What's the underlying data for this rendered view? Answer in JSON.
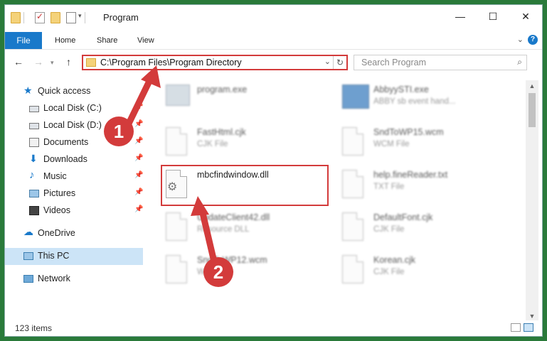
{
  "window": {
    "title": "Program",
    "controls": {
      "minimize": "—",
      "maximize": "☐",
      "close": "✕"
    }
  },
  "ribbon": {
    "tabs": [
      "File",
      "Home",
      "Share",
      "View"
    ],
    "help": "?"
  },
  "navbar": {
    "address_path": "C:\\Program Files\\Program Directory",
    "search_placeholder": "Search Program"
  },
  "sidebar": {
    "items": [
      {
        "label": "Quick access",
        "icon": "star-icon"
      },
      {
        "label": "Local Disk (C:)",
        "icon": "drive-icon",
        "pinned": true
      },
      {
        "label": "Local Disk (D:)",
        "icon": "drive-icon",
        "pinned": true
      },
      {
        "label": "Documents",
        "icon": "documents-icon",
        "pinned": true
      },
      {
        "label": "Downloads",
        "icon": "downloads-icon",
        "pinned": true
      },
      {
        "label": "Music",
        "icon": "music-icon",
        "pinned": true
      },
      {
        "label": "Pictures",
        "icon": "pictures-icon",
        "pinned": true
      },
      {
        "label": "Videos",
        "icon": "videos-icon",
        "pinned": true
      },
      {
        "label": "OneDrive",
        "icon": "cloud-icon"
      },
      {
        "label": "This PC",
        "icon": "computer-icon",
        "selected": true
      },
      {
        "label": "Network",
        "icon": "network-icon"
      }
    ]
  },
  "files": [
    {
      "name": "program.exe",
      "type": ""
    },
    {
      "name": "AbbyySTI.exe",
      "type": "ABBY sb event hand..."
    },
    {
      "name": "FastHtml.cjk",
      "type": "CJK File"
    },
    {
      "name": "SndToWP15.wcm",
      "type": "WCM File"
    },
    {
      "name": "mbcfindwindow.dll",
      "type": ""
    },
    {
      "name": "help.fineReader.txt",
      "type": "TXT File"
    },
    {
      "name": "UpdateClient42.dll",
      "type": "Resource DLL"
    },
    {
      "name": "DefaultFont.cjk",
      "type": "CJK File"
    },
    {
      "name": "SndToWP12.wcm",
      "type": "WCM File"
    },
    {
      "name": "Korean.cjk",
      "type": "CJK File"
    }
  ],
  "status": {
    "item_count": "123 items"
  },
  "annotations": {
    "step1": "1",
    "step2": "2"
  },
  "colors": {
    "accent": "#1979ca",
    "highlight": "#d33b3b",
    "selected": "#cce4f7"
  }
}
